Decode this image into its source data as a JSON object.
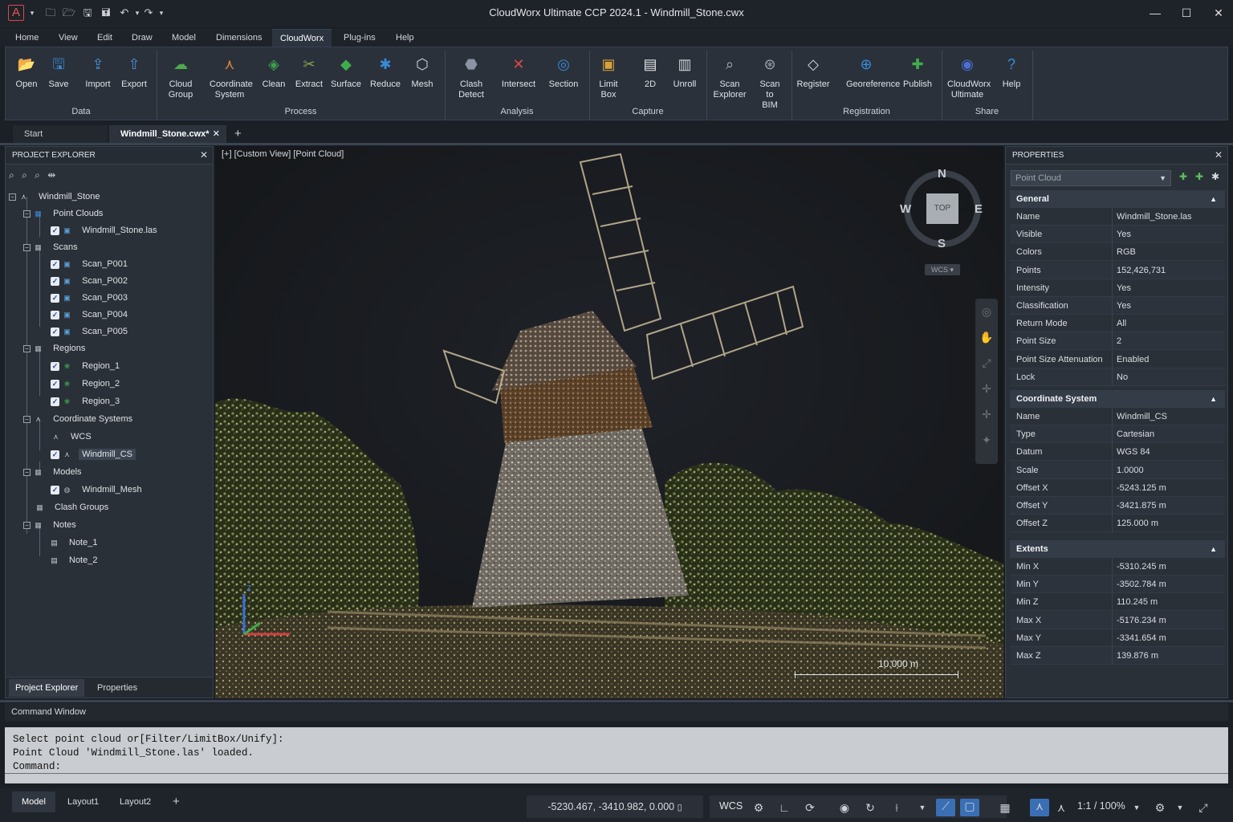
{
  "app": {
    "title": "CloudWorx Ultimate CCP 2024.1 - Windmill_Stone.cwx",
    "logo_letter": "A",
    "accent": "#3b8fd9"
  },
  "menu": [
    "Home",
    "View",
    "Edit",
    "Draw",
    "Model",
    "Dimensions",
    "CloudWorx",
    "Plug-ins",
    "Help"
  ],
  "ribbon": {
    "buttons": [
      {
        "label": "Open",
        "icon": "folder-icon"
      },
      {
        "label": "Save",
        "icon": "save-icon"
      },
      {
        "label": "Import",
        "icon": "import-icon"
      },
      {
        "label": "Export",
        "icon": "export-icon"
      },
      {
        "label": "Cloud\nGroup",
        "icon": "cloud-group-icon"
      },
      {
        "label": "Coordinate\nSystem",
        "icon": "coordinate-system-icon"
      },
      {
        "label": "Clean",
        "icon": "clean-icon"
      },
      {
        "label": "Extract",
        "icon": "extract-icon"
      },
      {
        "label": "Surface",
        "icon": "surface-icon"
      },
      {
        "label": "Reduce",
        "icon": "reduce-icon"
      },
      {
        "label": "Mesh",
        "icon": "mesh-icon"
      },
      {
        "label": "Clash\nDetect",
        "icon": "clash-detect-icon"
      },
      {
        "label": "Intersect",
        "icon": "intersect-icon"
      },
      {
        "label": "Section",
        "icon": "section-icon"
      },
      {
        "label": "Limit\nBox",
        "icon": "limit-box-icon"
      },
      {
        "label": "2D",
        "icon": "2d-icon"
      },
      {
        "label": "Unroll",
        "icon": "unroll-icon"
      },
      {
        "label": "Scan\nExplorer",
        "icon": "scan-explorer-icon"
      },
      {
        "label": "Scan\nto\nBIM",
        "icon": "scan-to-bim-icon"
      },
      {
        "label": "Register",
        "icon": "register-icon"
      },
      {
        "label": "Georeference",
        "icon": "georeference-icon"
      },
      {
        "label": "Publish",
        "icon": "publish-icon"
      },
      {
        "label": "CloudWorx\nUltimate",
        "icon": "cloudworx-ultimate-icon"
      },
      {
        "label": "Help",
        "icon": "help-icon"
      }
    ],
    "groups": [
      "Data",
      "Process",
      "Analysis",
      "Capture",
      "Registration",
      "Share"
    ]
  },
  "doc_tabs": [
    "Start",
    "Windmill_Stone.cwx*"
  ],
  "explorer": {
    "title": "PROJECT EXPLORER",
    "tree": {
      "root": "Windmill_Stone",
      "point_clouds": "Point Clouds",
      "point_cloud_file": "Windmill_Stone.las",
      "scans": "Scans",
      "scan_items": [
        "Scan_P001",
        "Scan_P002",
        "Scan_P003",
        "Scan_P004",
        "Scan_P005"
      ],
      "regions": "Regions",
      "region_items": [
        "Region_1",
        "Region_2",
        "Region_3"
      ],
      "coordinate_systems": "Coordinate Systems",
      "cs_items": [
        "WCS",
        "Windmill_CS"
      ],
      "models": "Models",
      "model_items": [
        "Windmill_Mesh"
      ],
      "clash_groups": "Clash Groups",
      "notes": "Notes",
      "note_items": [
        "Note_1",
        "Note_2"
      ]
    },
    "bottom_tabs": [
      "Project Explorer",
      "Properties"
    ]
  },
  "viewport": {
    "label": "[+] [Custom View] [Point Cloud]",
    "compass": {
      "n": "N",
      "s": "S",
      "e": "E",
      "w": "W",
      "top": "TOP"
    },
    "wcs": "WCS",
    "scale_label": "10.000 m",
    "axis_z": "Z"
  },
  "properties": {
    "title": "PROPERTIES",
    "selector": "Point Cloud",
    "general": {
      "title": "General",
      "rows": [
        {
          "k": "Name",
          "v": "Windmill_Stone.las"
        },
        {
          "k": "Visible",
          "v": "Yes"
        },
        {
          "k": "Colors",
          "v": "RGB"
        },
        {
          "k": "Points",
          "v": "152,426,731"
        },
        {
          "k": "Intensity",
          "v": "Yes"
        },
        {
          "k": "Classification",
          "v": "Yes"
        },
        {
          "k": "Return Mode",
          "v": "All"
        },
        {
          "k": "Point Size",
          "v": "2"
        },
        {
          "k": "Point Size Attenuation",
          "v": "Enabled"
        },
        {
          "k": "Lock",
          "v": "No"
        }
      ]
    },
    "coordinate_system": {
      "title": "Coordinate System",
      "rows": [
        {
          "k": "Name",
          "v": "Windmill_CS"
        },
        {
          "k": "Type",
          "v": "Cartesian"
        },
        {
          "k": "Datum",
          "v": "WGS 84"
        },
        {
          "k": "Scale",
          "v": "1.0000"
        },
        {
          "k": "Offset X",
          "v": "-5243.125 m"
        },
        {
          "k": "Offset Y",
          "v": "-3421.875 m"
        },
        {
          "k": "Offset Z",
          "v": "125.000 m"
        }
      ]
    },
    "extents": {
      "title": "Extents",
      "rows": [
        {
          "k": "Min X",
          "v": "-5310.245 m"
        },
        {
          "k": "Min Y",
          "v": "-3502.784 m"
        },
        {
          "k": "Min Z",
          "v": "110.245 m"
        },
        {
          "k": "Max X",
          "v": "-5176.234 m"
        },
        {
          "k": "Max Y",
          "v": "-3341.654 m"
        },
        {
          "k": "Max Z",
          "v": "139.876 m"
        }
      ]
    }
  },
  "command": {
    "title": "Command Window",
    "lines": [
      "Select point cloud or[Filter/LimitBox/Unify]:",
      "Point Cloud 'Windmill_Stone.las' loaded.",
      "Command:"
    ]
  },
  "status": {
    "tabs": [
      "Model",
      "Layout1",
      "Layout2"
    ],
    "coords": "-5230.467, -3410.982,  0.000",
    "ucs": "WCS",
    "scale": "1:1 / 100%"
  }
}
